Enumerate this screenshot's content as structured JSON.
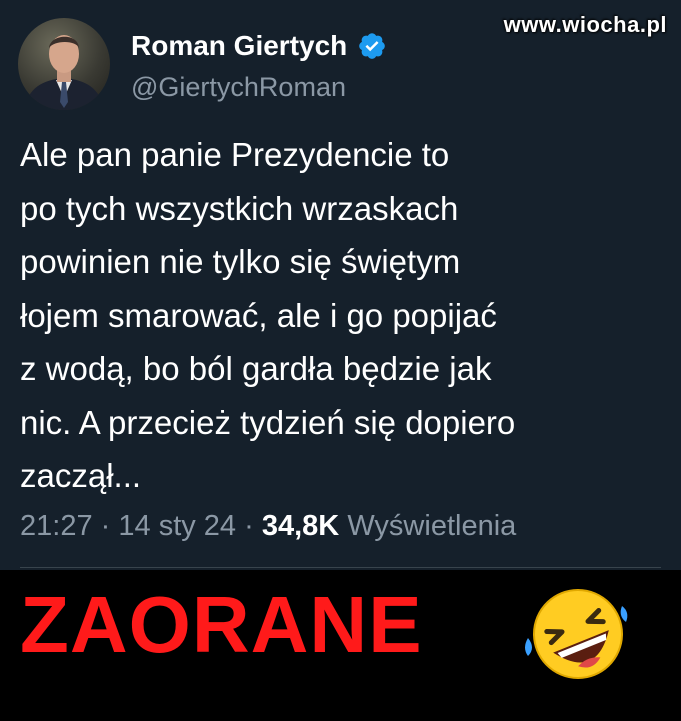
{
  "watermark": "www.wiocha.pl",
  "author": {
    "name": "Roman Giertych",
    "handle": "@GiertychRoman",
    "verified": true
  },
  "tweet": {
    "lines": [
      "Ale pan panie Prezydencie to",
      "po tych wszystkich wrzaskach",
      "powinien nie tylko się świętym",
      "łojem smarować, ale i go popijać",
      "z wodą, bo ból gardła będzie jak",
      "nic. A przecież tydzień się dopiero",
      "zaczął..."
    ]
  },
  "meta": {
    "time": "21:27",
    "date": "14 sty 24",
    "views_count": "34,8K",
    "views_label": "Wyświetlenia",
    "separator": "·"
  },
  "caption": "ZAORANE",
  "colors": {
    "background": "#15202b",
    "text": "#ffffff",
    "muted": "#8b98a5",
    "verified": "#1d9bf0",
    "caption": "#ff1a1a"
  },
  "icons": {
    "verified": "verified-badge-icon",
    "emoji": "rolling-on-floor-laughing-emoji"
  }
}
